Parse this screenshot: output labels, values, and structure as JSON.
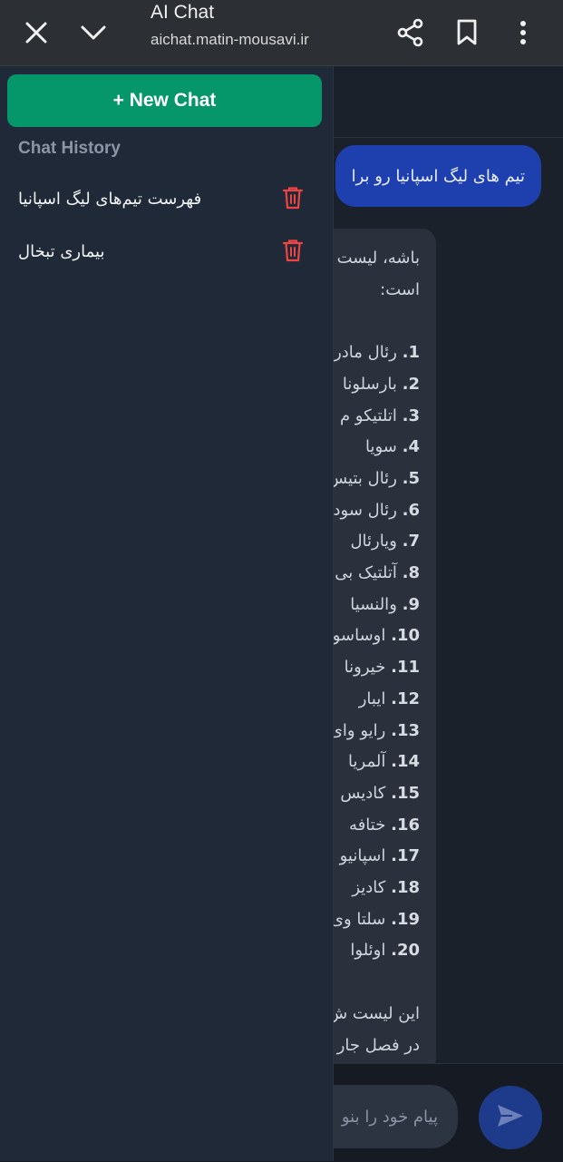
{
  "browser": {
    "title": "AI Chat",
    "url": "aichat.matin-mousavi.ir",
    "icons": [
      "close-icon",
      "chevron-down-icon",
      "share-icon",
      "bookmark-icon",
      "more-vert-icon"
    ]
  },
  "sidebar": {
    "new_chat_label": "+ New Chat",
    "history_title": "Chat History",
    "items": [
      {
        "label": "فهرست تیم‌های لیگ اسپانیا",
        "icon": "trash-icon"
      },
      {
        "label": "بیماری تبخال",
        "icon": "trash-icon"
      }
    ]
  },
  "chat": {
    "user_message": "تیم های لیگ اسپانیا رو برا",
    "ai_intro_1": "باشه، لیست",
    "ai_intro_2": "است:",
    "ai_list": [
      {
        "num": "1.",
        "text": "رئال مادر"
      },
      {
        "num": "2.",
        "text": "بارسلونا"
      },
      {
        "num": "3.",
        "text": "اتلتیکو م"
      },
      {
        "num": "4.",
        "text": "سویا"
      },
      {
        "num": "5.",
        "text": "رئال بتیس"
      },
      {
        "num": "6.",
        "text": "رئال سود"
      },
      {
        "num": "7.",
        "text": "ویارئال"
      },
      {
        "num": "8.",
        "text": "آتلتیک بی"
      },
      {
        "num": "9.",
        "text": "والنسیا"
      },
      {
        "num": "10.",
        "text": "اوساسو"
      },
      {
        "num": "11.",
        "text": "خیرونا"
      },
      {
        "num": "12.",
        "text": "ایبار"
      },
      {
        "num": "13.",
        "text": "رایو وای"
      },
      {
        "num": "14.",
        "text": "آلمریا"
      },
      {
        "num": "15.",
        "text": "کادیس"
      },
      {
        "num": "16.",
        "text": "ختافه"
      },
      {
        "num": "17.",
        "text": "اسپانیو"
      },
      {
        "num": "18.",
        "text": "کادیز"
      },
      {
        "num": "19.",
        "text": "سلتا وی"
      },
      {
        "num": "20.",
        "text": "اوئلوا"
      }
    ],
    "ai_outro_1": "این لیست ش",
    "ai_outro_2": "در فصل جار",
    "input_placeholder": "پیام خود را بنو",
    "send_icon": "send-icon"
  },
  "colors": {
    "accent_green": "#059669",
    "user_bubble": "#1e40af",
    "send_button": "#1e3a8a",
    "trash_red": "#ef4444"
  }
}
